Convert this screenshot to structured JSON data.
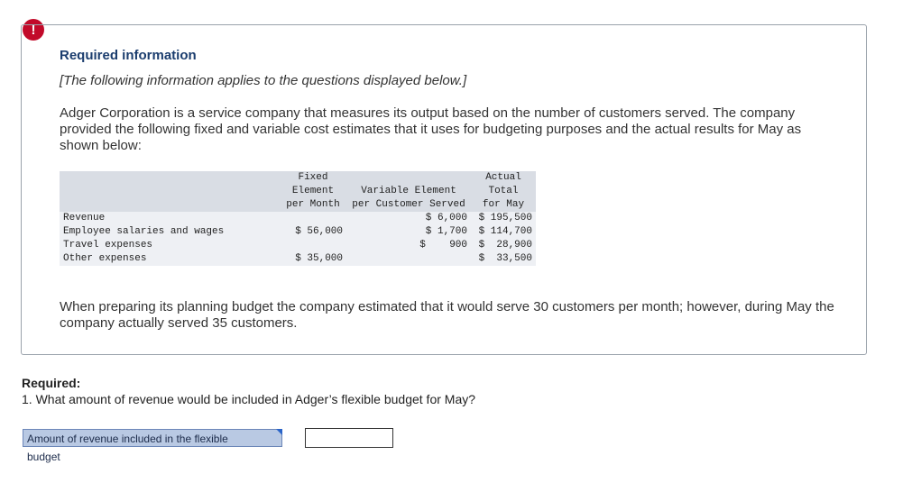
{
  "alert": {
    "symbol": "!"
  },
  "info": {
    "title": "Required information",
    "subtitle": "[The following information applies to the questions displayed below.]",
    "intro": "Adger Corporation is a service company that measures its output based on the number of customers served. The company provided the following fixed and variable cost estimates that it uses for budgeting purposes and the actual results for May as shown below:",
    "note": "When preparing its planning budget the company estimated that it would serve 30 customers per month; however, during May the company actually served 35 customers."
  },
  "table": {
    "headers": [
      "",
      "Fixed\nElement\nper Month",
      "Variable Element\nper Customer Served",
      "Actual\nTotal\nfor May"
    ],
    "rows": [
      {
        "label": "Revenue",
        "fixed": "",
        "variable": "$ 6,000",
        "actual": "$ 195,500"
      },
      {
        "label": "Employee salaries and wages",
        "fixed": "$ 56,000",
        "variable": "$ 1,700",
        "actual": "$ 114,700"
      },
      {
        "label": "Travel expenses",
        "fixed": "",
        "variable": "$    900",
        "actual": "$  28,900"
      },
      {
        "label": "Other expenses",
        "fixed": "$ 35,000",
        "variable": "",
        "actual": "$  33,500"
      }
    ]
  },
  "required": {
    "heading": "Required:",
    "question": "1. What amount of revenue would be included in Adger’s flexible budget for May?"
  },
  "answer": {
    "label": "Amount of revenue included in the flexible budget",
    "value": ""
  }
}
